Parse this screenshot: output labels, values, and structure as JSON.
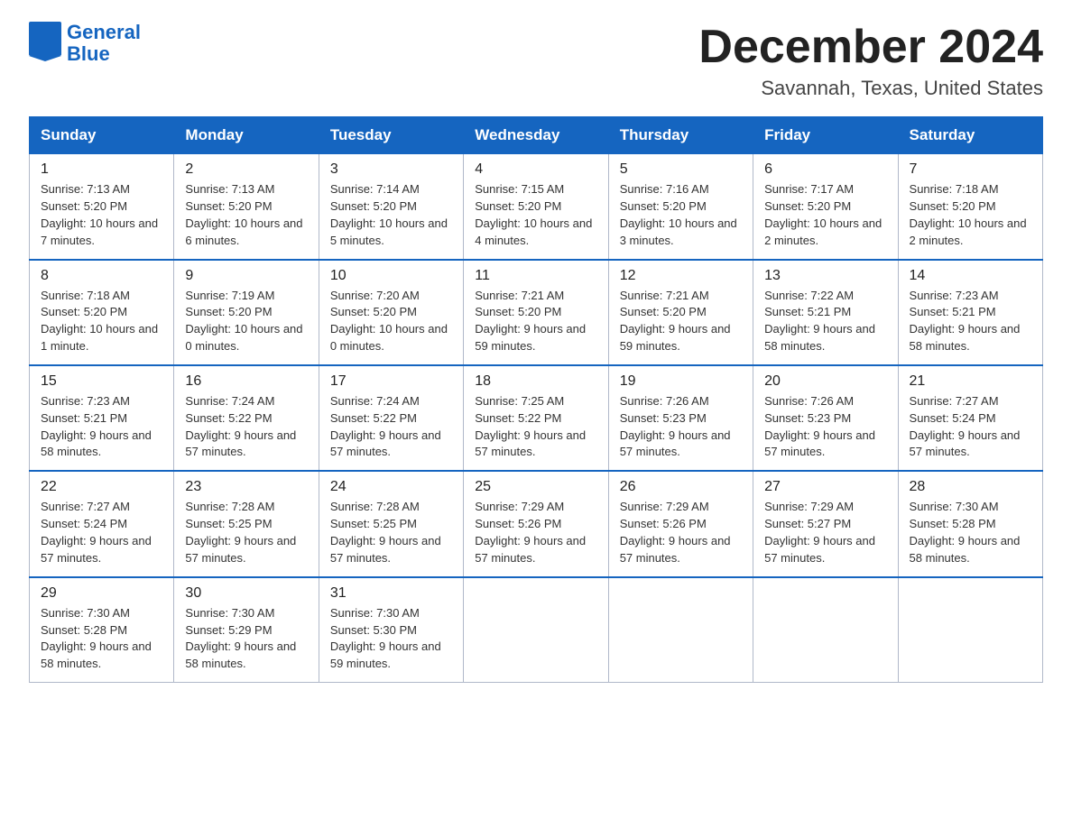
{
  "header": {
    "logo_general": "General",
    "logo_blue": "Blue",
    "month_title": "December 2024",
    "location": "Savannah, Texas, United States"
  },
  "days_of_week": [
    "Sunday",
    "Monday",
    "Tuesday",
    "Wednesday",
    "Thursday",
    "Friday",
    "Saturday"
  ],
  "weeks": [
    [
      {
        "day": "1",
        "sunrise": "7:13 AM",
        "sunset": "5:20 PM",
        "daylight": "10 hours and 7 minutes."
      },
      {
        "day": "2",
        "sunrise": "7:13 AM",
        "sunset": "5:20 PM",
        "daylight": "10 hours and 6 minutes."
      },
      {
        "day": "3",
        "sunrise": "7:14 AM",
        "sunset": "5:20 PM",
        "daylight": "10 hours and 5 minutes."
      },
      {
        "day": "4",
        "sunrise": "7:15 AM",
        "sunset": "5:20 PM",
        "daylight": "10 hours and 4 minutes."
      },
      {
        "day": "5",
        "sunrise": "7:16 AM",
        "sunset": "5:20 PM",
        "daylight": "10 hours and 3 minutes."
      },
      {
        "day": "6",
        "sunrise": "7:17 AM",
        "sunset": "5:20 PM",
        "daylight": "10 hours and 2 minutes."
      },
      {
        "day": "7",
        "sunrise": "7:18 AM",
        "sunset": "5:20 PM",
        "daylight": "10 hours and 2 minutes."
      }
    ],
    [
      {
        "day": "8",
        "sunrise": "7:18 AM",
        "sunset": "5:20 PM",
        "daylight": "10 hours and 1 minute."
      },
      {
        "day": "9",
        "sunrise": "7:19 AM",
        "sunset": "5:20 PM",
        "daylight": "10 hours and 0 minutes."
      },
      {
        "day": "10",
        "sunrise": "7:20 AM",
        "sunset": "5:20 PM",
        "daylight": "10 hours and 0 minutes."
      },
      {
        "day": "11",
        "sunrise": "7:21 AM",
        "sunset": "5:20 PM",
        "daylight": "9 hours and 59 minutes."
      },
      {
        "day": "12",
        "sunrise": "7:21 AM",
        "sunset": "5:20 PM",
        "daylight": "9 hours and 59 minutes."
      },
      {
        "day": "13",
        "sunrise": "7:22 AM",
        "sunset": "5:21 PM",
        "daylight": "9 hours and 58 minutes."
      },
      {
        "day": "14",
        "sunrise": "7:23 AM",
        "sunset": "5:21 PM",
        "daylight": "9 hours and 58 minutes."
      }
    ],
    [
      {
        "day": "15",
        "sunrise": "7:23 AM",
        "sunset": "5:21 PM",
        "daylight": "9 hours and 58 minutes."
      },
      {
        "day": "16",
        "sunrise": "7:24 AM",
        "sunset": "5:22 PM",
        "daylight": "9 hours and 57 minutes."
      },
      {
        "day": "17",
        "sunrise": "7:24 AM",
        "sunset": "5:22 PM",
        "daylight": "9 hours and 57 minutes."
      },
      {
        "day": "18",
        "sunrise": "7:25 AM",
        "sunset": "5:22 PM",
        "daylight": "9 hours and 57 minutes."
      },
      {
        "day": "19",
        "sunrise": "7:26 AM",
        "sunset": "5:23 PM",
        "daylight": "9 hours and 57 minutes."
      },
      {
        "day": "20",
        "sunrise": "7:26 AM",
        "sunset": "5:23 PM",
        "daylight": "9 hours and 57 minutes."
      },
      {
        "day": "21",
        "sunrise": "7:27 AM",
        "sunset": "5:24 PM",
        "daylight": "9 hours and 57 minutes."
      }
    ],
    [
      {
        "day": "22",
        "sunrise": "7:27 AM",
        "sunset": "5:24 PM",
        "daylight": "9 hours and 57 minutes."
      },
      {
        "day": "23",
        "sunrise": "7:28 AM",
        "sunset": "5:25 PM",
        "daylight": "9 hours and 57 minutes."
      },
      {
        "day": "24",
        "sunrise": "7:28 AM",
        "sunset": "5:25 PM",
        "daylight": "9 hours and 57 minutes."
      },
      {
        "day": "25",
        "sunrise": "7:29 AM",
        "sunset": "5:26 PM",
        "daylight": "9 hours and 57 minutes."
      },
      {
        "day": "26",
        "sunrise": "7:29 AM",
        "sunset": "5:26 PM",
        "daylight": "9 hours and 57 minutes."
      },
      {
        "day": "27",
        "sunrise": "7:29 AM",
        "sunset": "5:27 PM",
        "daylight": "9 hours and 57 minutes."
      },
      {
        "day": "28",
        "sunrise": "7:30 AM",
        "sunset": "5:28 PM",
        "daylight": "9 hours and 58 minutes."
      }
    ],
    [
      {
        "day": "29",
        "sunrise": "7:30 AM",
        "sunset": "5:28 PM",
        "daylight": "9 hours and 58 minutes."
      },
      {
        "day": "30",
        "sunrise": "7:30 AM",
        "sunset": "5:29 PM",
        "daylight": "9 hours and 58 minutes."
      },
      {
        "day": "31",
        "sunrise": "7:30 AM",
        "sunset": "5:30 PM",
        "daylight": "9 hours and 59 minutes."
      },
      null,
      null,
      null,
      null
    ]
  ]
}
